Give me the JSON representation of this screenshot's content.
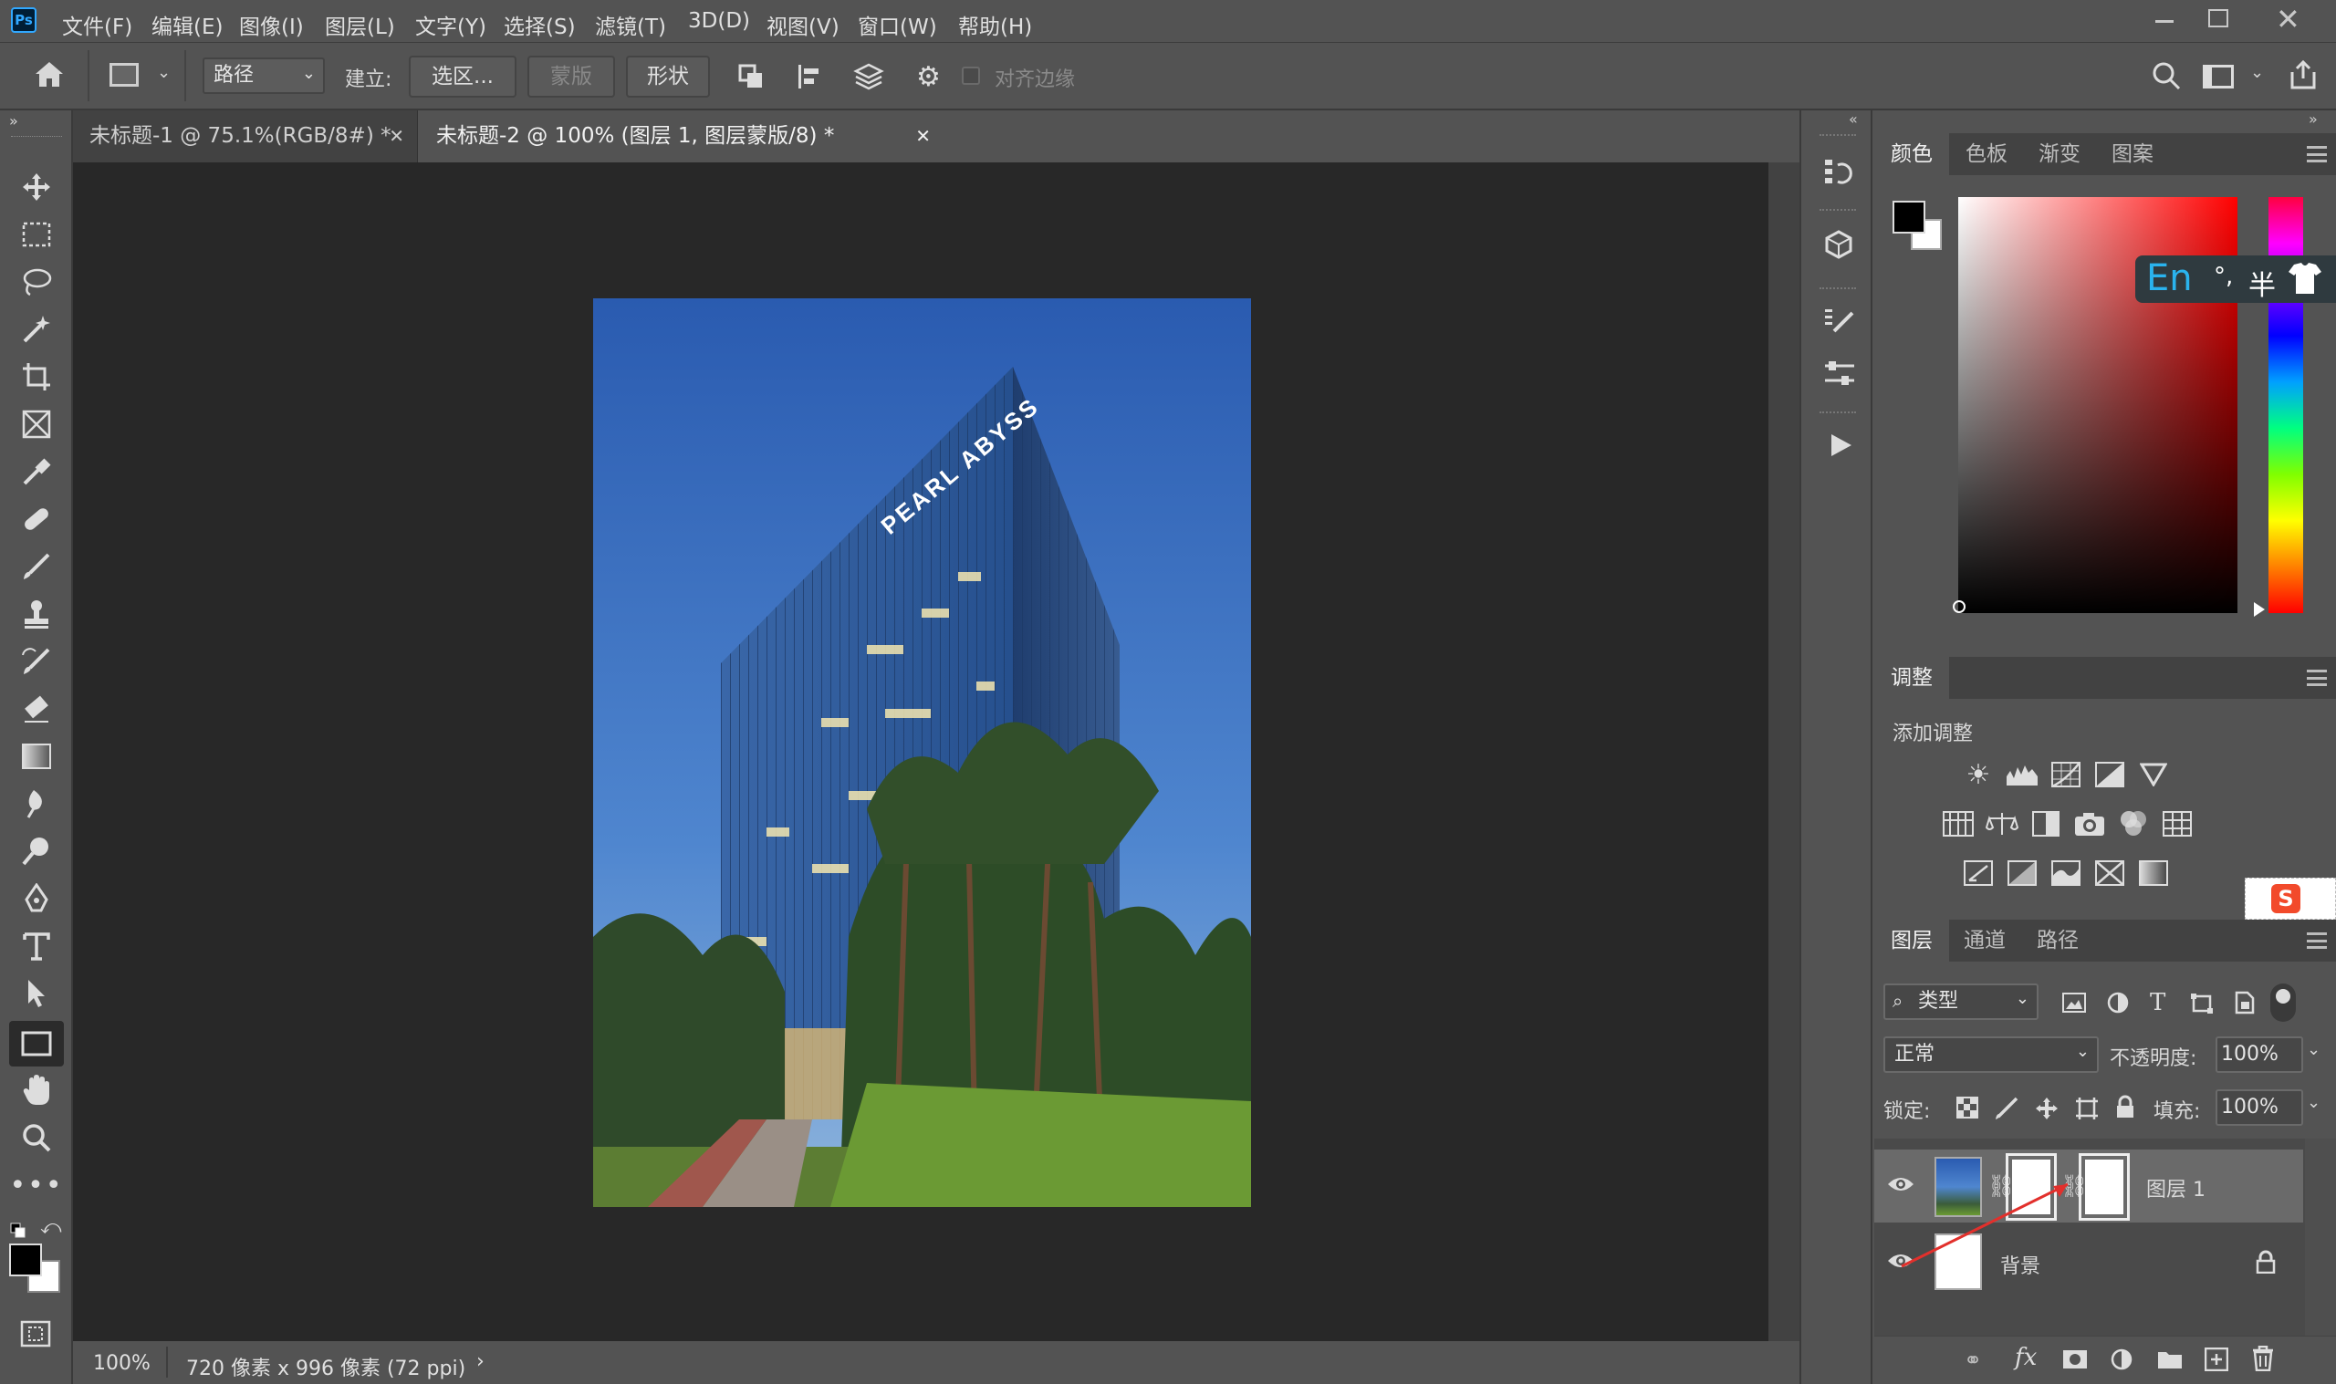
{
  "app": {
    "logo": "Ps"
  },
  "menu": [
    "文件(F)",
    "编辑(E)",
    "图像(I)",
    "图层(L)",
    "文字(Y)",
    "选择(S)",
    "滤镜(T)",
    "3D(D)",
    "视图(V)",
    "窗口(W)",
    "帮助(H)"
  ],
  "options": {
    "mode_value": "路径",
    "build_label": "建立:",
    "selection_btn": "选区...",
    "mask_btn": "蒙版",
    "shape_btn": "形状",
    "align_edges_label": "对齐边缘"
  },
  "tabs": [
    {
      "label": "未标题-1 @ 75.1%(RGB/8#) *",
      "active": false
    },
    {
      "label": "未标题-2 @ 100% (图层 1, 图层蒙版/8) *",
      "active": true
    }
  ],
  "photo": {
    "building_sign": "PEARL ABYSS"
  },
  "status": {
    "zoom": "100%",
    "doc_info": "720 像素 x 996 像素 (72 ppi)"
  },
  "color_panel": {
    "tabs": [
      "颜色",
      "色板",
      "渐变",
      "图案"
    ],
    "foreground": "#000000",
    "background": "#ffffff",
    "hue_color": "#ff0000"
  },
  "ime": {
    "lang": "En",
    "punct": "°,",
    "width": "半"
  },
  "adjust_panel": {
    "tab": "调整",
    "add_label": "添加调整"
  },
  "layers_panel": {
    "tabs": [
      "图层",
      "通道",
      "路径"
    ],
    "filter_kind": "类型",
    "blend_mode": "正常",
    "opacity_label": "不透明度:",
    "opacity_value": "100%",
    "lock_label": "锁定:",
    "fill_label": "填充:",
    "fill_value": "100%",
    "layers": [
      {
        "name": "图层 1"
      },
      {
        "name": "背景"
      }
    ]
  }
}
